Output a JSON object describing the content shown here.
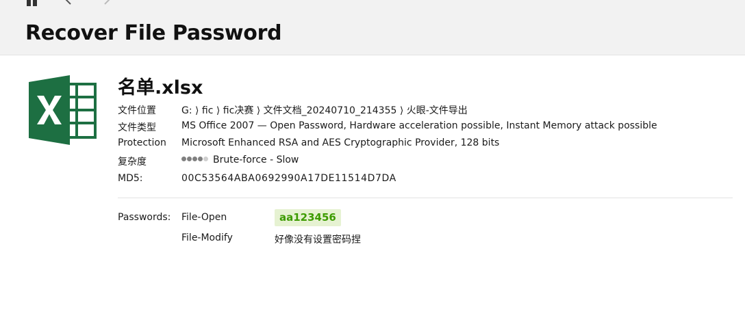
{
  "header": {
    "title": "Recover File Password"
  },
  "file": {
    "icon": "excel-file-icon",
    "name": "名单.xlsx"
  },
  "details": {
    "location": {
      "label": "文件位置",
      "value": "G: ⟩ fic ⟩ fic决赛 ⟩ 文件文档_20240710_214355 ⟩ 火眼-文件导出"
    },
    "type": {
      "label": "文件类型",
      "value": "MS Office 2007 — Open Password, Hardware acceleration possible, Instant Memory attack possible"
    },
    "protection": {
      "label": "Protection",
      "value": "Microsoft Enhanced RSA and AES Cryptographic Provider, 128 bits"
    },
    "complexity": {
      "label": "复杂度",
      "value": "Brute-force - Slow",
      "level": 4,
      "max_level": 5
    },
    "md5": {
      "label": "MD5:",
      "value": "00C53564ABA0692990A17DE11514D7DA"
    }
  },
  "passwords": {
    "label": "Passwords:",
    "open": {
      "label": "File-Open",
      "value": "aa123456"
    },
    "modify": {
      "label": "File-Modify",
      "value": "好像没有设置密码捏"
    }
  },
  "colors": {
    "excel_green": "#1d6f42",
    "password_green": "#3c9b00",
    "password_bg": "#e6f2d2"
  }
}
